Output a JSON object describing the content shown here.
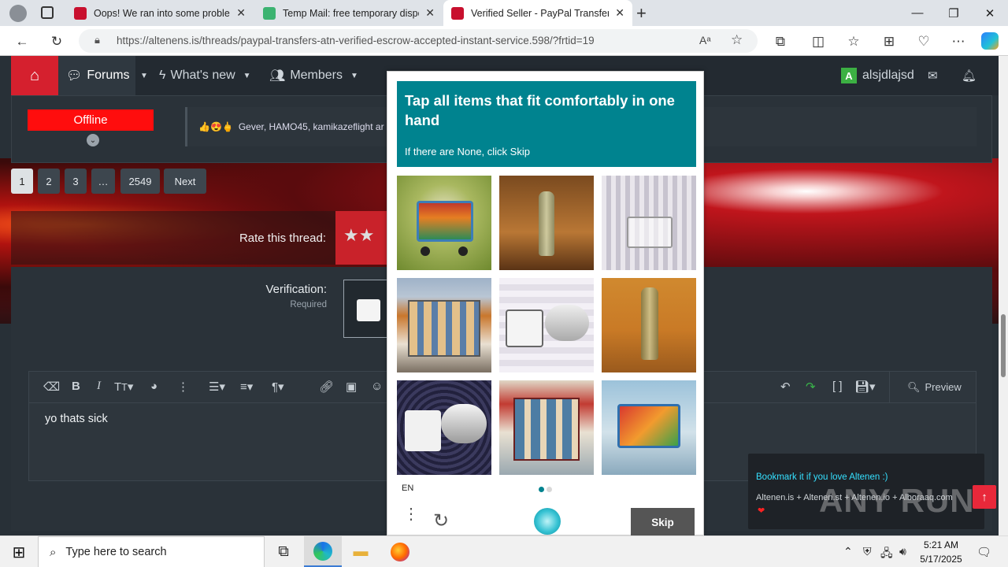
{
  "browser": {
    "tabs": [
      {
        "title": "Oops! We ran into some problem",
        "favicon_color": "#c8102e"
      },
      {
        "title": "Temp Mail: free temporary dispo",
        "favicon_color": "#3cb371"
      },
      {
        "title": "Verified Seller - PayPal Transfers -",
        "favicon_color": "#c8102e"
      }
    ],
    "url": "https://altenens.is/threads/paypal-transfers-atn-verified-escrow-accepted-instant-service.598/?frtid=19"
  },
  "site": {
    "nav": {
      "home_icon": "home-icon",
      "items": [
        {
          "label": "Forums"
        },
        {
          "label": "What's new"
        },
        {
          "label": "Members"
        }
      ],
      "user": {
        "avatar_letter": "A",
        "name": "alsjdlajsd",
        "avatar_color": "#3cb043"
      }
    },
    "post": {
      "status": "Offline",
      "reactions_text": "Gever, HAMO45, kamikazeflight ar"
    },
    "pagination": [
      "1",
      "2",
      "3",
      "…",
      "2549",
      "Next"
    ],
    "rate_label": "Rate this thread:",
    "verification": {
      "label": "Verification:",
      "required": "Required"
    },
    "editor": {
      "text": "yo thats sick",
      "preview_label": "Preview"
    },
    "toast": {
      "title": "Bookmark it if you love Altenen :)",
      "links": "Altenen.is + Altenen.st + Altenen.io + Alboraaq.com"
    },
    "watermark": "ANY RUN"
  },
  "captcha": {
    "title": "Tap all items that fit comfortably in one hand",
    "subtitle": "If there are None, click Skip",
    "tiles": [
      {
        "subject": "shopping cart on grass"
      },
      {
        "subject": "glass bottle"
      },
      {
        "subject": "shopping cart in store aisle"
      },
      {
        "subject": "market kiosk"
      },
      {
        "subject": "cement mixer truck"
      },
      {
        "subject": "glass bottle"
      },
      {
        "subject": "cement mixer truck"
      },
      {
        "subject": "news kiosk"
      },
      {
        "subject": "shopping cart with groceries"
      }
    ],
    "language": "EN",
    "skip_label": "Skip",
    "accent_color": "#00838f"
  },
  "taskbar": {
    "search_placeholder": "Type here to search",
    "time": "5:21 AM",
    "date": "5/17/2025"
  }
}
